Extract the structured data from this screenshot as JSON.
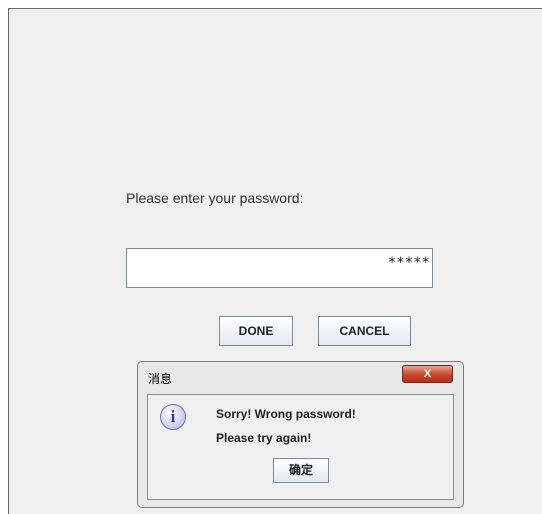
{
  "form": {
    "prompt": "Please enter your password:",
    "password_value": "*****",
    "done_label": "DONE",
    "cancel_label": "CANCEL"
  },
  "dialog": {
    "title": "消息",
    "close_label": "X",
    "icon": "info-icon",
    "icon_glyph": "i",
    "message_line1": "Sorry! Wrong password!",
    "message_line2": "Please try again!",
    "ok_label": "确定"
  },
  "colors": {
    "panel_background": "#f0f0f0",
    "close_button": "#c8452a",
    "info_icon": "#c9c9ef"
  }
}
